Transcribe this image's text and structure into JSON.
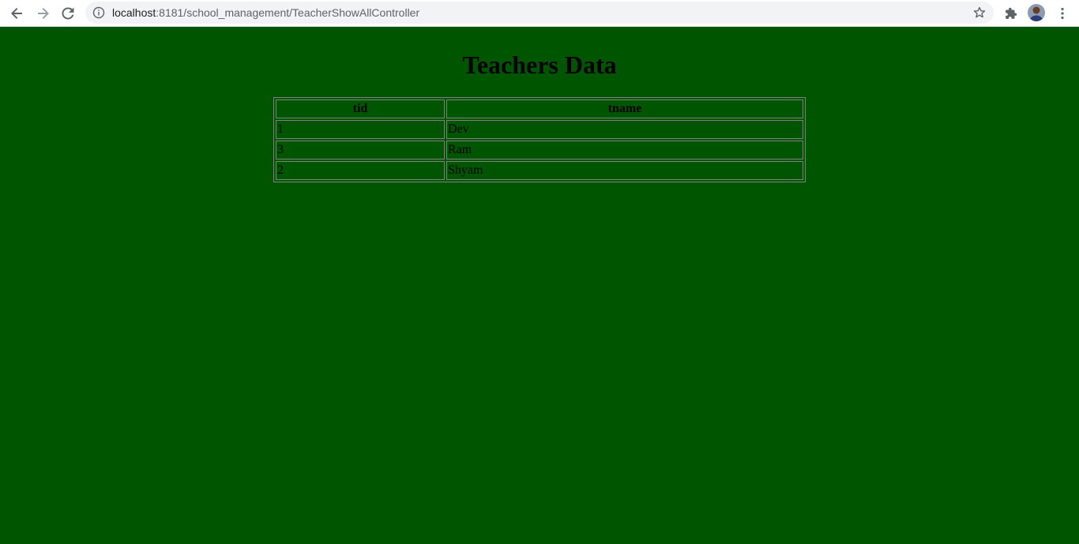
{
  "browser": {
    "url_host": "localhost",
    "url_path": ":8181/school_management/TeacherShowAllController",
    "icons": {
      "back": "arrow-left-icon",
      "forward": "arrow-right-icon",
      "reload": "reload-icon",
      "info": "info-icon",
      "bookmark": "star-icon",
      "extensions": "puzzle-icon",
      "menu": "kebab-menu-icon"
    }
  },
  "page": {
    "background_color": "#005500",
    "title": "Teachers Data",
    "table": {
      "headers": [
        "tid",
        "tname"
      ],
      "rows": [
        {
          "tid": "1",
          "tname": "Dev"
        },
        {
          "tid": "3",
          "tname": "Ram"
        },
        {
          "tid": "2",
          "tname": "Shyam"
        }
      ]
    }
  }
}
